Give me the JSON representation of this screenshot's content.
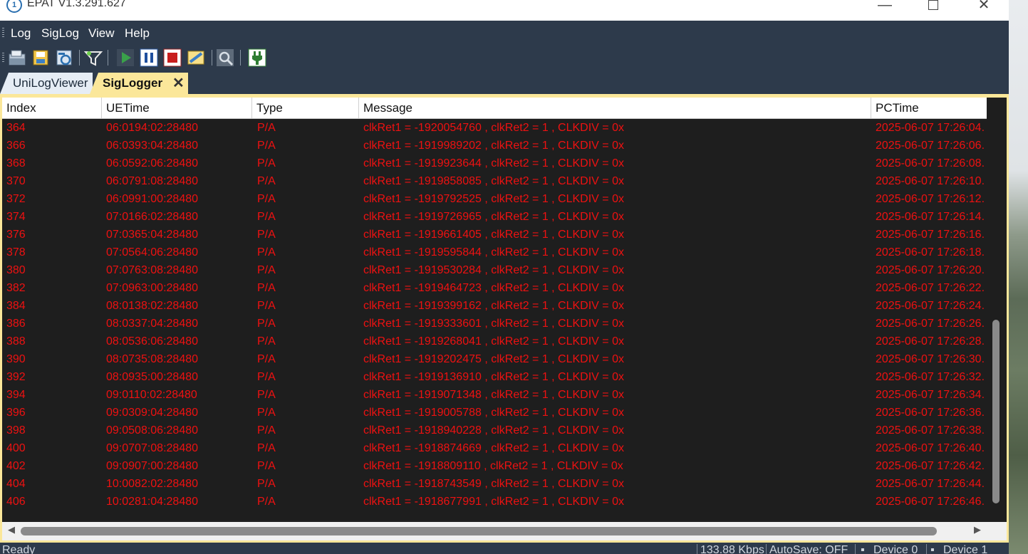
{
  "window": {
    "title": "EPAT V1.3.291.627",
    "min_glyph": "—",
    "close_glyph": "✕"
  },
  "menu": [
    "Log",
    "SigLog",
    "View",
    "Help"
  ],
  "toolbar": [
    "open-file-icon",
    "save-file-icon",
    "refresh-icon",
    "filter-icon",
    "play-icon",
    "pause-icon",
    "stop-icon",
    "clear-icon",
    "find-icon",
    "connect-icon"
  ],
  "tabs": [
    {
      "label": "UniLogViewer",
      "active": false
    },
    {
      "label": "SigLogger",
      "active": true,
      "close": "✕"
    }
  ],
  "table": {
    "columns": [
      "Index",
      "UETime",
      "Type",
      "Message",
      "PCTime"
    ],
    "rows": [
      [
        "364",
        "06:0194:02:28480",
        "P/A",
        "clkRet1 = -1920054760 , clkRet2 = 1 , CLKDIV = 0x",
        "2025-06-07 17:26:04."
      ],
      [
        "366",
        "06:0393:04:28480",
        "P/A",
        "clkRet1 = -1919989202 , clkRet2 = 1 , CLKDIV = 0x",
        "2025-06-07 17:26:06."
      ],
      [
        "368",
        "06:0592:06:28480",
        "P/A",
        "clkRet1 = -1919923644 , clkRet2 = 1 , CLKDIV = 0x",
        "2025-06-07 17:26:08."
      ],
      [
        "370",
        "06:0791:08:28480",
        "P/A",
        "clkRet1 = -1919858085 , clkRet2 = 1 , CLKDIV = 0x",
        "2025-06-07 17:26:10."
      ],
      [
        "372",
        "06:0991:00:28480",
        "P/A",
        "clkRet1 = -1919792525 , clkRet2 = 1 , CLKDIV = 0x",
        "2025-06-07 17:26:12."
      ],
      [
        "374",
        "07:0166:02:28480",
        "P/A",
        "clkRet1 = -1919726965 , clkRet2 = 1 , CLKDIV = 0x",
        "2025-06-07 17:26:14."
      ],
      [
        "376",
        "07:0365:04:28480",
        "P/A",
        "clkRet1 = -1919661405 , clkRet2 = 1 , CLKDIV = 0x",
        "2025-06-07 17:26:16."
      ],
      [
        "378",
        "07:0564:06:28480",
        "P/A",
        "clkRet1 = -1919595844 , clkRet2 = 1 , CLKDIV = 0x",
        "2025-06-07 17:26:18."
      ],
      [
        "380",
        "07:0763:08:28480",
        "P/A",
        "clkRet1 = -1919530284 , clkRet2 = 1 , CLKDIV = 0x",
        "2025-06-07 17:26:20."
      ],
      [
        "382",
        "07:0963:00:28480",
        "P/A",
        "clkRet1 = -1919464723 , clkRet2 = 1 , CLKDIV = 0x",
        "2025-06-07 17:26:22."
      ],
      [
        "384",
        "08:0138:02:28480",
        "P/A",
        "clkRet1 = -1919399162 , clkRet2 = 1 , CLKDIV = 0x",
        "2025-06-07 17:26:24."
      ],
      [
        "386",
        "08:0337:04:28480",
        "P/A",
        "clkRet1 = -1919333601 , clkRet2 = 1 , CLKDIV = 0x",
        "2025-06-07 17:26:26."
      ],
      [
        "388",
        "08:0536:06:28480",
        "P/A",
        "clkRet1 = -1919268041 , clkRet2 = 1 , CLKDIV = 0x",
        "2025-06-07 17:26:28."
      ],
      [
        "390",
        "08:0735:08:28480",
        "P/A",
        "clkRet1 = -1919202475 , clkRet2 = 1 , CLKDIV = 0x",
        "2025-06-07 17:26:30."
      ],
      [
        "392",
        "08:0935:00:28480",
        "P/A",
        "clkRet1 = -1919136910 , clkRet2 = 1 , CLKDIV = 0x",
        "2025-06-07 17:26:32."
      ],
      [
        "394",
        "09:0110:02:28480",
        "P/A",
        "clkRet1 = -1919071348 , clkRet2 = 1 , CLKDIV = 0x",
        "2025-06-07 17:26:34."
      ],
      [
        "396",
        "09:0309:04:28480",
        "P/A",
        "clkRet1 = -1919005788 , clkRet2 = 1 , CLKDIV = 0x",
        "2025-06-07 17:26:36."
      ],
      [
        "398",
        "09:0508:06:28480",
        "P/A",
        "clkRet1 = -1918940228 , clkRet2 = 1 , CLKDIV = 0x",
        "2025-06-07 17:26:38."
      ],
      [
        "400",
        "09:0707:08:28480",
        "P/A",
        "clkRet1 = -1918874669 , clkRet2 = 1 , CLKDIV = 0x",
        "2025-06-07 17:26:40."
      ],
      [
        "402",
        "09:0907:00:28480",
        "P/A",
        "clkRet1 = -1918809110 , clkRet2 = 1 , CLKDIV = 0x",
        "2025-06-07 17:26:42."
      ],
      [
        "404",
        "10:0082:02:28480",
        "P/A",
        "clkRet1 = -1918743549 , clkRet2 = 1 , CLKDIV = 0x",
        "2025-06-07 17:26:44."
      ],
      [
        "406",
        "10:0281:04:28480",
        "P/A",
        "clkRet1 = -1918677991 , clkRet2 = 1 , CLKDIV = 0x",
        "2025-06-07 17:26:46."
      ]
    ]
  },
  "status": {
    "left": "Ready",
    "bitrate": "133.88 Kbps",
    "autosave": "AutoSave: OFF",
    "device0": "Device 0",
    "device1": "Device 1"
  },
  "colors": {
    "row_text": "#ee1111",
    "grid_bg": "#1e1e1e",
    "chrome": "#2d3a4b",
    "active_tab": "#fbe79a"
  }
}
